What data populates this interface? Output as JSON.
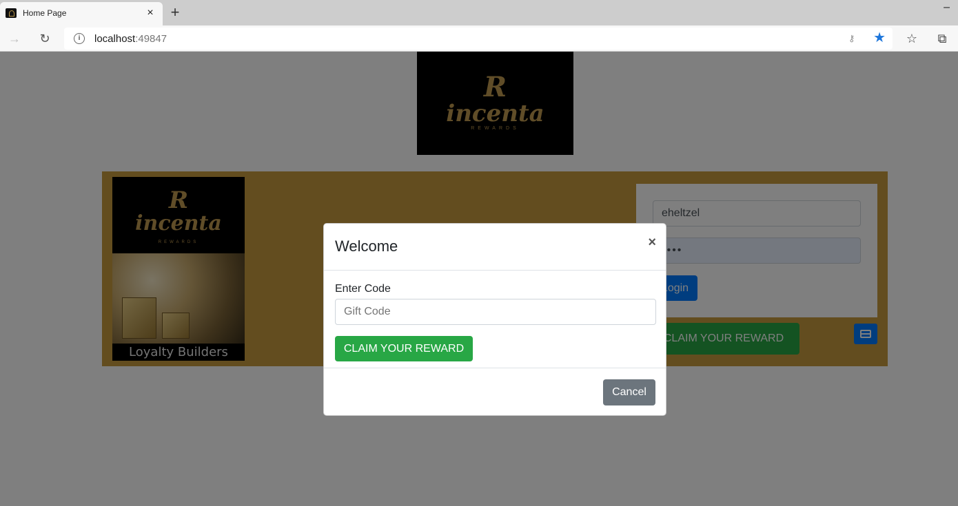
{
  "browser": {
    "tab_title": "Home Page",
    "tab_close": "×",
    "new_tab": "+",
    "url_host": "localhost",
    "url_port": ":49847",
    "minimize": "–"
  },
  "brand": {
    "logo_letter": "R",
    "logo_word": "incenta",
    "logo_sub": "REWARDS"
  },
  "promo_card": {
    "caption": "Loyalty Builders"
  },
  "login": {
    "username_value": "eheltzel",
    "password_value": "••••",
    "login_label": "Login",
    "claim_label": "CLAIM YOUR REWARD"
  },
  "modal": {
    "title": "Welcome",
    "close_label": "×",
    "code_label": "Enter Code",
    "code_placeholder": "Gift Code",
    "code_value": "",
    "claim_label": "CLAIM YOUR REWARD",
    "cancel_label": "Cancel"
  },
  "colors": {
    "banner": "#c79a3e",
    "primary": "#007bff",
    "success": "#28a745",
    "secondary": "#6c757d",
    "gold": "#c19a50"
  },
  "icons": [
    "info-icon",
    "key-icon",
    "star-icon",
    "favorites-list-icon",
    "collections-icon",
    "back-arrow-icon",
    "reload-icon",
    "credit-card-icon",
    "close-icon"
  ]
}
